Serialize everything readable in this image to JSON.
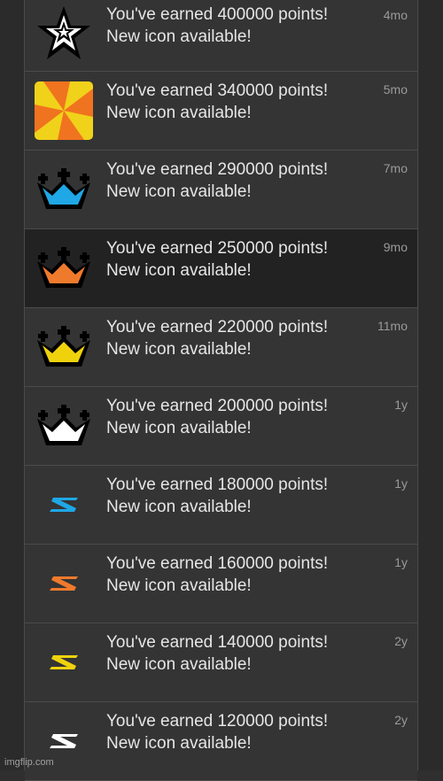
{
  "notifications": [
    {
      "line1": "You've earned 400000 points!",
      "line2": "New icon available!",
      "time": "4mo",
      "icon": "star-icon"
    },
    {
      "line1": "You've earned 340000 points!",
      "line2": "New icon available!",
      "time": "5mo",
      "icon": "pinwheel-icon"
    },
    {
      "line1": "You've earned 290000 points!",
      "line2": "New icon available!",
      "time": "7mo",
      "icon": "crown-icon",
      "color": "#1fa7e6"
    },
    {
      "line1": "You've earned 250000 points!",
      "line2": "New icon available!",
      "time": "9mo",
      "icon": "crown-icon",
      "color": "#f07a2c"
    },
    {
      "line1": "You've earned 220000 points!",
      "line2": "New icon available!",
      "time": "11mo",
      "icon": "crown-icon",
      "color": "#f0d20c"
    },
    {
      "line1": "You've earned 200000 points!",
      "line2": "New icon available!",
      "time": "1y",
      "icon": "crown-icon",
      "color": "#ffffff"
    },
    {
      "line1": "You've earned 180000 points!",
      "line2": "New icon available!",
      "time": "1y",
      "icon": "lightning-icon",
      "color": "#1fa7e6"
    },
    {
      "line1": "You've earned 160000 points!",
      "line2": "New icon available!",
      "time": "1y",
      "icon": "lightning-icon",
      "color": "#f07a2c"
    },
    {
      "line1": "You've earned 140000 points!",
      "line2": "New icon available!",
      "time": "2y",
      "icon": "lightning-icon",
      "color": "#f0d20c"
    },
    {
      "line1": "You've earned 120000 points!",
      "line2": "New icon available!",
      "time": "2y",
      "icon": "lightning-icon",
      "color": "#ffffff"
    }
  ],
  "watermark": "imgflip.com"
}
